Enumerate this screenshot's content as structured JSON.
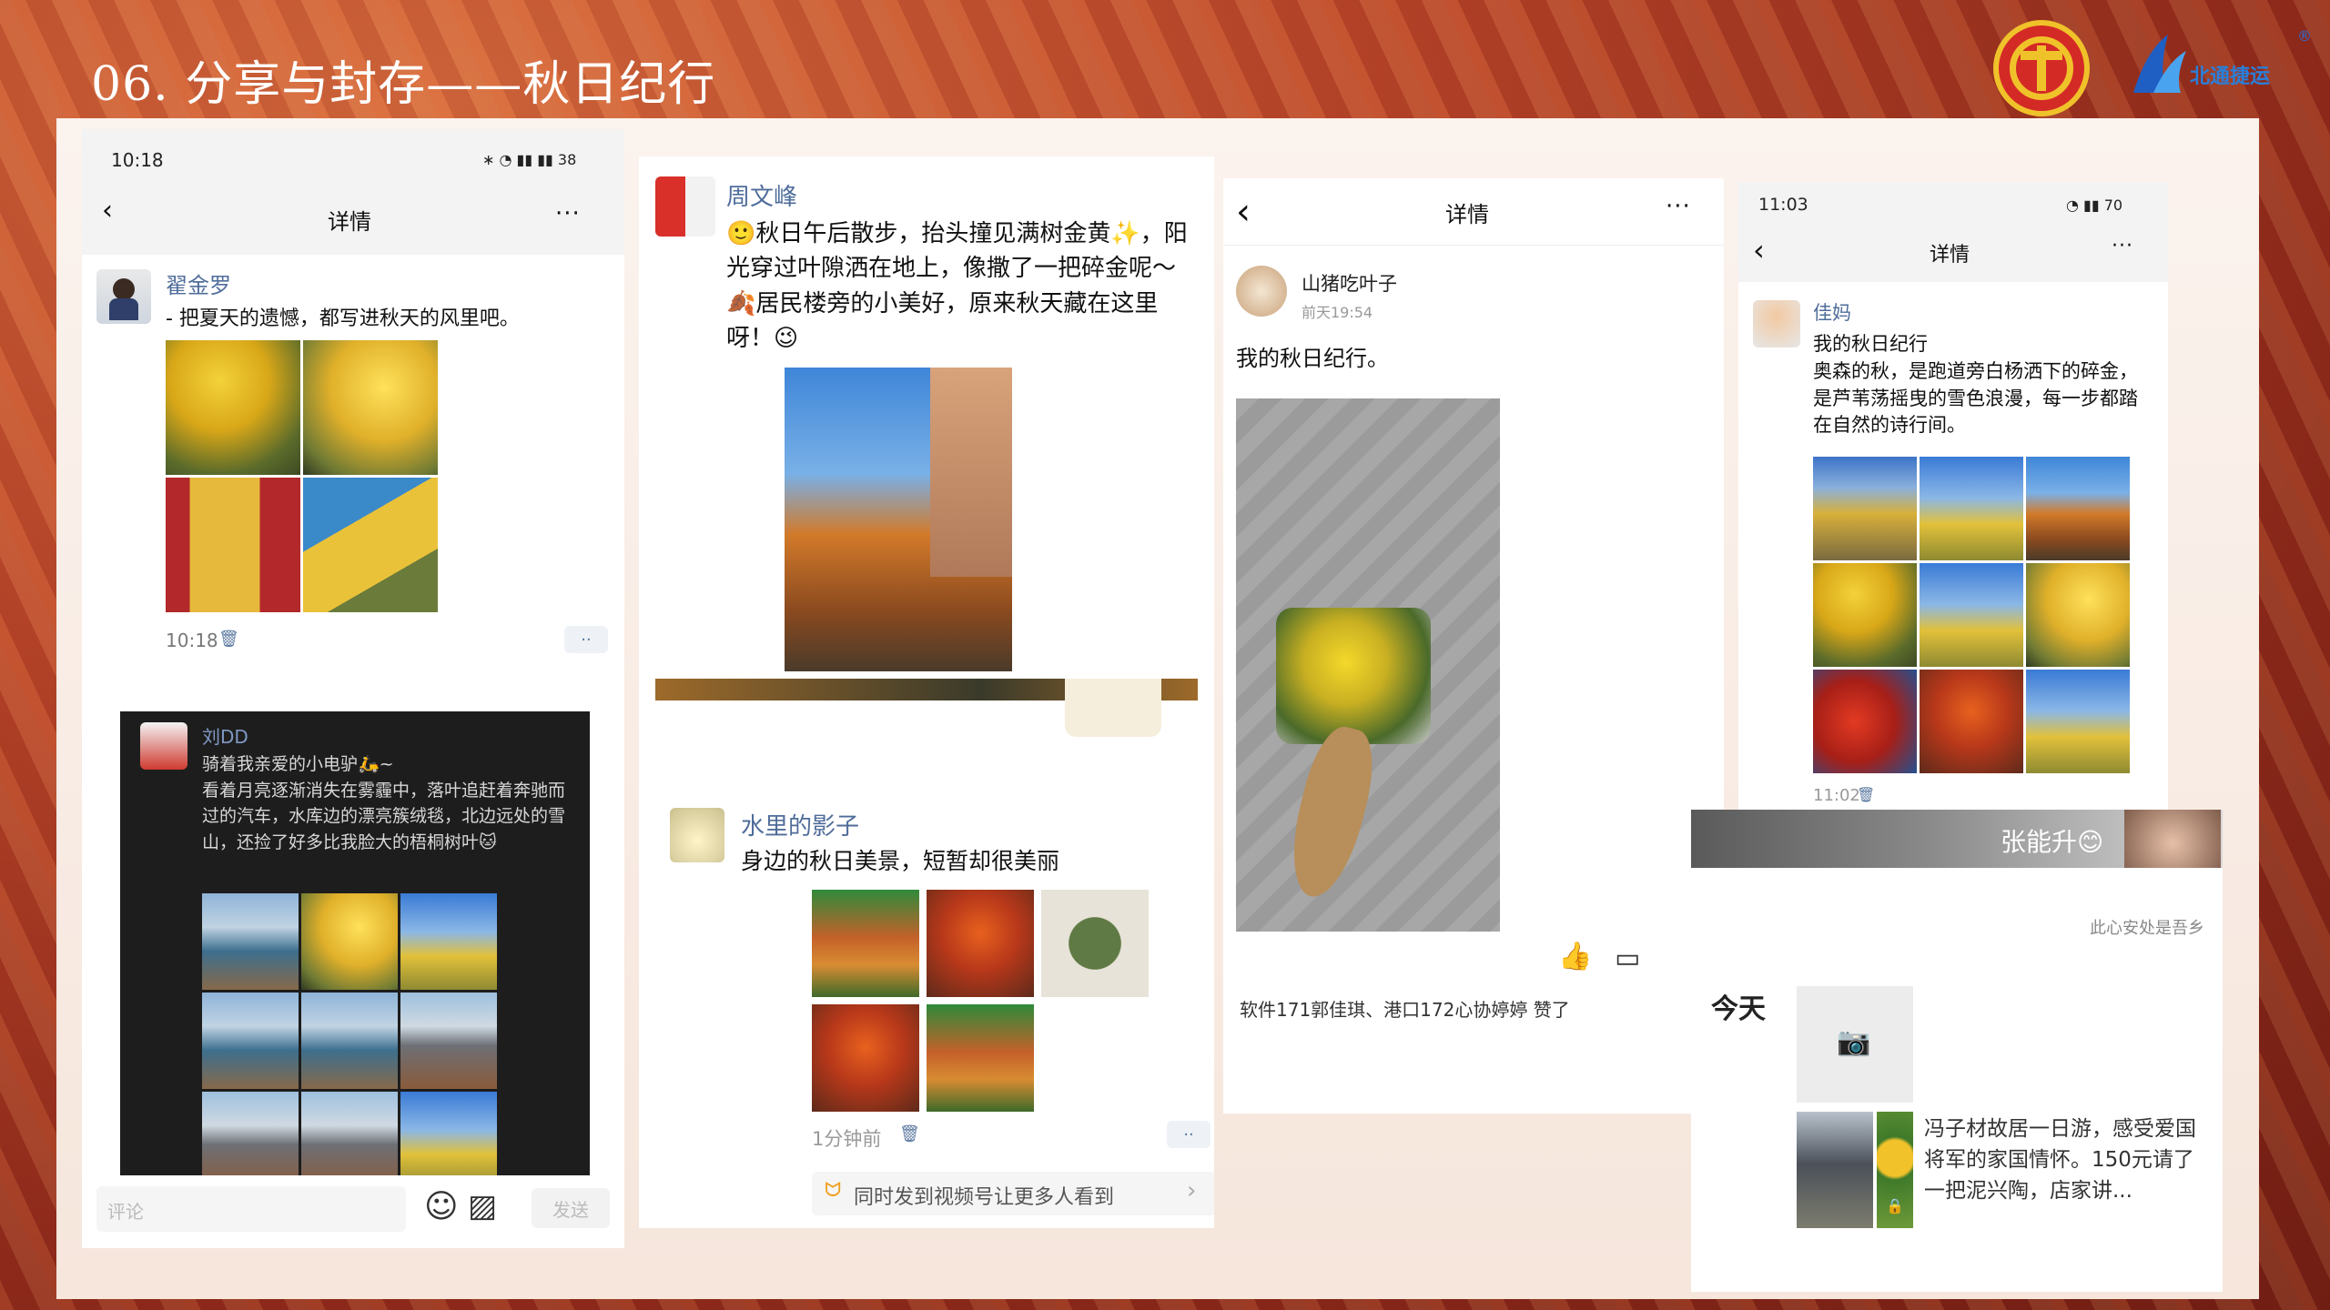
{
  "slide": {
    "title": "06. 分享与封存——秋日纪行",
    "brand_reg": "®",
    "brand_text": "北通捷运"
  },
  "card1": {
    "status_time": "10:18",
    "status_right": "∗ ◔ ▮▮ ▮▮ 38",
    "nav_title": "详情",
    "back_label": "‹",
    "more_label": "···",
    "user": "翟金罗",
    "text": "- 把夏天的遗憾，都写进秋天的风里吧。",
    "time": "10:18",
    "delete_icon": "🗑",
    "dots": "··",
    "dark": {
      "user": "刘DD",
      "text": "骑着我亲爱的小电驴🛵~\n看着月亮逐渐消失在雾霾中，落叶追赶着奔驰而过的汽车，水库边的漂亮簇绒毯，北边远处的雪山，还捡了好多比我脸大的梧桐树叶🐱"
    },
    "comment_placeholder": "评论",
    "send_label": "发送",
    "emoji_icon": "☺",
    "image_icon": "▨"
  },
  "card2": {
    "user": "周文峰",
    "text": "🙂秋日午后散步，抬头撞见满树金黄✨，阳光穿过叶隙洒在地上，像撒了一把碎金呢～🍂居民楼旁的小美好，原来秋天藏在这里呀！😉",
    "user2": "水里的影子",
    "text2": "身边的秋日美景，短暂却很美丽",
    "time2": "1分钟前",
    "delete_icon": "🗑",
    "dots": "··",
    "share_text": "同时发到视频号让更多人看到",
    "share_icon": "ᗢ",
    "chevron": "›"
  },
  "card3": {
    "nav_title": "详情",
    "back_label": "‹",
    "more_label": "···",
    "user": "山猪吃叶子",
    "time": "前天19:54",
    "text": "我的秋日纪行。",
    "like_icon": "👍",
    "comment_icon": "▭",
    "likes_text": "软件171郭佳琪、港口172心协婷婷 赞了"
  },
  "card4": {
    "status_time": "11:03",
    "status_right": "◔ ▮▮ 70",
    "nav_title": "详情",
    "back_label": "‹",
    "more_label": "···",
    "user": "佳妈",
    "text": "我的秋日纪行\n奥森的秋，是跑道旁白杨洒下的碎金，是芦苇荡摇曳的雪色浪漫，每一步都踏在自然的诗行间。",
    "time": "11:02",
    "delete_icon": "🗑"
  },
  "card5": {
    "name_bubble": "张能升😊",
    "signature": "此心安处是吾乡",
    "today": "今天",
    "camera_icon": "📷",
    "lock_icon": "🔒",
    "post_text": "冯子材故居一日游，感受爱国将军的家国情怀。150元请了一把泥兴陶，店家讲..."
  }
}
